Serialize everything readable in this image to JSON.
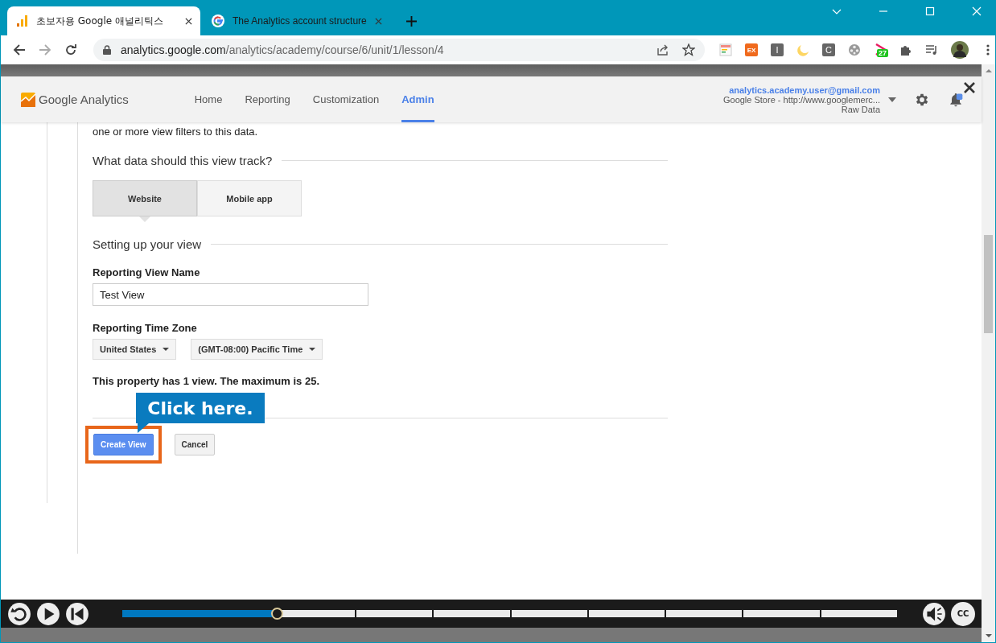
{
  "browser": {
    "tabs": [
      {
        "title": "초보자용 Google 애널리틱스",
        "selected": true
      },
      {
        "title": "The Analytics account structure",
        "selected": false
      }
    ],
    "url": {
      "host": "analytics.google.com",
      "path": "/analytics/academy/course/6/unit/1/lesson/4"
    },
    "extensions": [
      {
        "kind": "notes"
      },
      {
        "kind": "ex",
        "label": "EX"
      },
      {
        "kind": "letter",
        "label": "I"
      },
      {
        "kind": "moon"
      },
      {
        "kind": "letter",
        "label": "C"
      },
      {
        "kind": "reel"
      },
      {
        "kind": "badge",
        "label": "27"
      },
      {
        "kind": "puzzle"
      },
      {
        "kind": "media"
      }
    ]
  },
  "ga_header": {
    "product": "Google Analytics",
    "nav": [
      {
        "label": "Home",
        "selected": false
      },
      {
        "label": "Reporting",
        "selected": false
      },
      {
        "label": "Customization",
        "selected": false
      },
      {
        "label": "Admin",
        "selected": true
      }
    ],
    "account": {
      "email": "analytics.academy.user@gmail.com",
      "property": "Google Store - http://www.googlemerc...",
      "view": "Raw Data"
    }
  },
  "form": {
    "intro": "one or more view filters to this data.",
    "track_heading": "What data should this view track?",
    "track_options": [
      {
        "label": "Website",
        "selected": true
      },
      {
        "label": "Mobile app",
        "selected": false
      }
    ],
    "setup_heading": "Setting up your view",
    "view_name": {
      "label": "Reporting View Name",
      "value": "Test View"
    },
    "time_zone": {
      "label": "Reporting Time Zone",
      "country": "United States",
      "zone": "(GMT-08:00) Pacific Time"
    },
    "view_count_note": "This property has 1 view. The maximum is 25.",
    "buttons": [
      {
        "label": "Create View",
        "kind": "primary",
        "highlighted": true
      },
      {
        "label": "Cancel",
        "kind": "secondary",
        "highlighted": false
      }
    ]
  },
  "callout": "Click here.",
  "player": {
    "level": 0.2,
    "captions": "CC"
  }
}
